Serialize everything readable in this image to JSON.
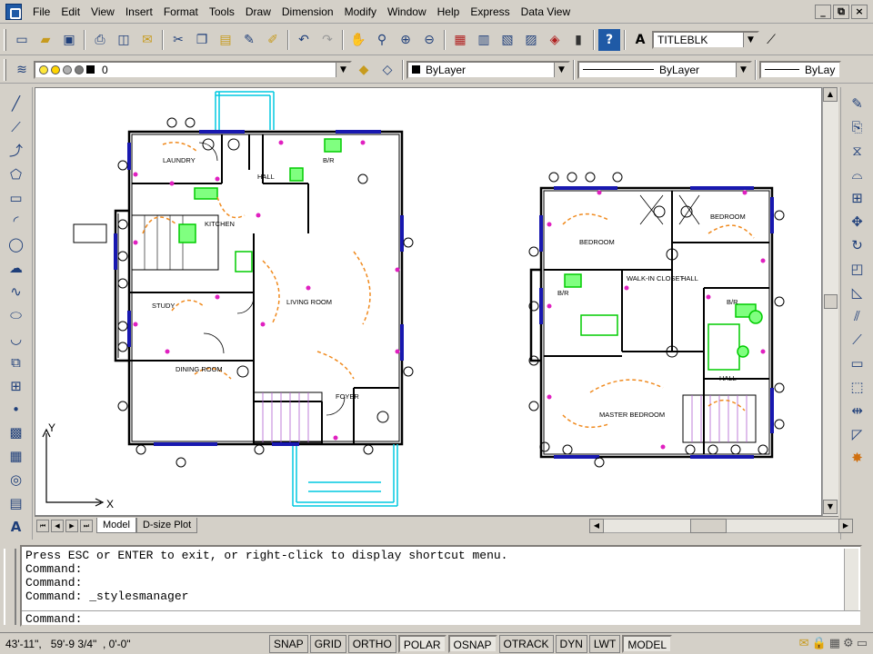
{
  "menu": [
    "File",
    "Edit",
    "View",
    "Insert",
    "Format",
    "Tools",
    "Draw",
    "Dimension",
    "Modify",
    "Window",
    "Help",
    "Express",
    "Data View"
  ],
  "window_controls": [
    "_",
    "⧉",
    "×"
  ],
  "toolbar1": {
    "icons": [
      "new-file-icon",
      "open-file-icon",
      "save-icon",
      "print-icon",
      "plot-preview-icon",
      "publish-icon",
      "cut-icon",
      "copy-icon",
      "paste-icon",
      "match-properties-icon",
      "block-editor-icon",
      "undo-icon",
      "redo-icon",
      "pan-icon",
      "zoom-realtime-icon",
      "zoom-window-icon",
      "zoom-previous-icon",
      "properties-icon",
      "design-center-icon",
      "tool-palettes-icon",
      "sheet-set-icon",
      "markup-icon",
      "quickcalc-icon",
      "help-icon",
      "text-style-icon"
    ],
    "text_style": "TITLEBLK"
  },
  "toolbar2": {
    "layer_name": "0",
    "color": "ByLayer",
    "linetype": "ByLayer",
    "lineweight": "ByLay"
  },
  "left_tools": [
    "line-icon",
    "construction-line-icon",
    "polyline-icon",
    "polygon-icon",
    "rectangle-icon",
    "arc-icon",
    "circle-icon",
    "revision-cloud-icon",
    "spline-icon",
    "ellipse-icon",
    "ellipse-arc-icon",
    "insert-block-icon",
    "make-block-icon",
    "point-icon",
    "hatch-icon",
    "gradient-icon",
    "region-icon",
    "table-icon",
    "multiline-text-icon"
  ],
  "right_tools": [
    "erase-icon",
    "copy-object-icon",
    "mirror-icon",
    "offset-icon",
    "array-icon",
    "move-icon",
    "rotate-icon",
    "scale-icon",
    "stretch-icon",
    "trim-icon",
    "extend-icon",
    "break-icon",
    "join-icon",
    "chamfer-icon",
    "fillet-icon",
    "explode-icon"
  ],
  "drawing": {
    "room_labels": [
      "LAUNDRY",
      "KITCHEN",
      "STUDY",
      "DINING ROOM",
      "LIVING ROOM",
      "FOYER",
      "HALL",
      "B/R",
      "BEDROOM",
      "BEDROOM",
      "WALK-IN CLOSET",
      "HALL",
      "B/R",
      "B/R",
      "HALL",
      "MASTER BEDROOM"
    ],
    "ucs_x": "X",
    "ucs_y": "Y"
  },
  "layout_tabs": [
    "Model",
    "D-size Plot"
  ],
  "command_history": [
    "Press ESC or ENTER to exit, or right-click to display shortcut menu.",
    "Command:",
    "Command:",
    "Command: _stylesmanager"
  ],
  "command_prompt": "Command:",
  "status": {
    "coordinates": "43'-11\",   59'-9 3/4\"  , 0'-0\"",
    "toggles": [
      {
        "label": "SNAP",
        "on": false
      },
      {
        "label": "GRID",
        "on": false
      },
      {
        "label": "ORTHO",
        "on": false
      },
      {
        "label": "POLAR",
        "on": true
      },
      {
        "label": "OSNAP",
        "on": true
      },
      {
        "label": "OTRACK",
        "on": false
      },
      {
        "label": "DYN",
        "on": false
      },
      {
        "label": "LWT",
        "on": false
      },
      {
        "label": "MODEL",
        "on": true
      }
    ]
  }
}
